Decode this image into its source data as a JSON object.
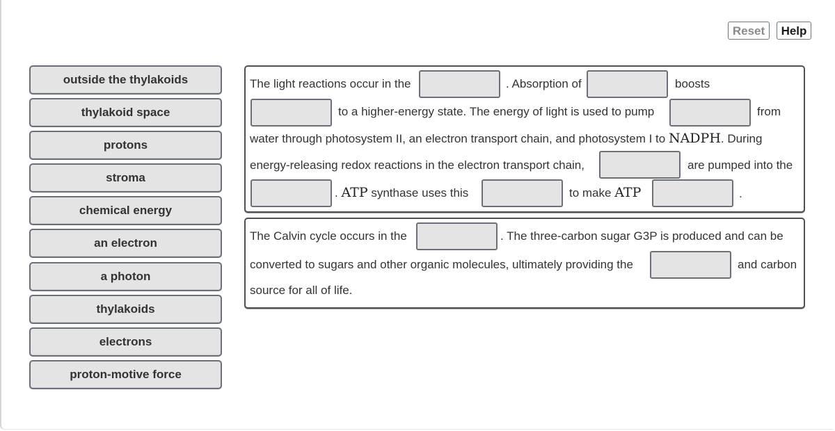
{
  "toolbar": {
    "reset_label": "Reset",
    "help_label": "Help"
  },
  "labels": [
    "outside the thylakoids",
    "thylakoid space",
    "protons",
    "stroma",
    "chemical energy",
    "an electron",
    "a photon",
    "thylakoids",
    "electrons",
    "proton-motive force"
  ],
  "panel1": {
    "seg1": "The light reactions occur in the",
    "seg2": ". Absorption of",
    "seg3": "boosts",
    "seg4": "to a higher-energy state. The energy of light is used to pump",
    "seg5": "from",
    "seg6a": "water through photosystem II, an electron transport chain, and photosystem I to",
    "seg6_math": "NADPH",
    "seg6b": ". During",
    "seg7": "energy-releasing redox reactions in the electron transport chain,",
    "seg8": "are pumped into the",
    "seg9a": ".",
    "seg9_math": "ATP",
    "seg9b": "synthase uses this",
    "seg10a": "to make",
    "seg10_math": "ATP",
    "seg11": "."
  },
  "panel2": {
    "seg1": "The Calvin cycle occurs in the",
    "seg2": ". The three-carbon sugar G3P is produced and can be",
    "seg3": "converted to sugars and other organic molecules, ultimately providing the",
    "seg4": "and carbon",
    "seg5": "source for all of life."
  }
}
